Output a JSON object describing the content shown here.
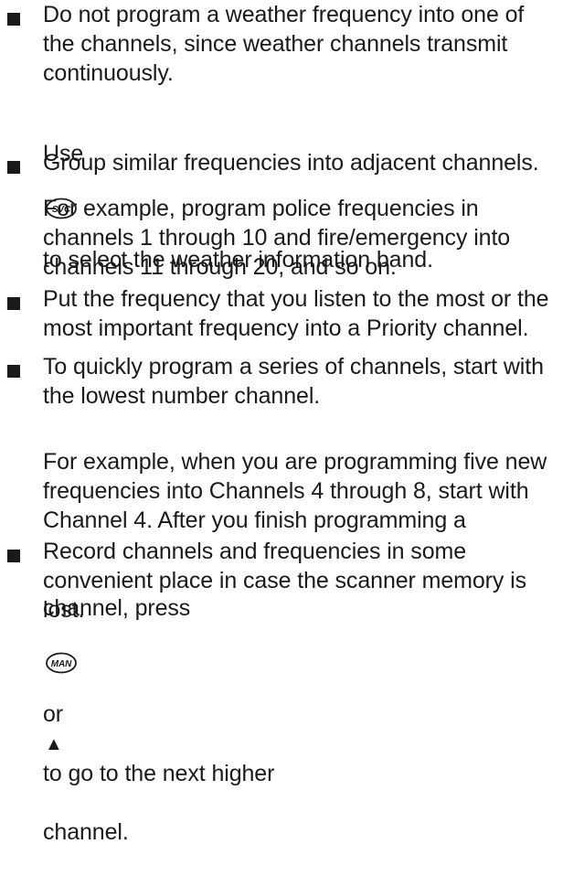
{
  "items": [
    {
      "bullet": true,
      "text": "Do not program a weather frequency into one of\nthe channels, since weather channels transmit\ncontinuously."
    },
    {
      "bullet": false,
      "text_before": "Use",
      "key": "SVC",
      "text_after": "to select the weather information band."
    },
    {
      "bullet": true,
      "text": "Group similar frequencies into adjacent channels."
    },
    {
      "bullet": false,
      "text": "For example, program police frequencies in\nchannels 1 through 10 and fire/emergency into\nchannels 11 through 20, and so on."
    },
    {
      "bullet": true,
      "text": "Put the frequency that you listen to the most or the\nmost important frequency into a Priority channel."
    },
    {
      "bullet": true,
      "text": "To quickly program a series of channels, start with\nthe lowest number channel."
    },
    {
      "bullet": false,
      "text": "For example, when you are programming five new\nfrequencies into Channels 4 through 8, start with\nChannel 4. After you finish programming a",
      "last_line_before": "channel, press",
      "key": "MAN",
      "last_line_mid": "or",
      "arrow": "▲",
      "last_line_after": "to go to the next higher",
      "final_line": "channel."
    },
    {
      "bullet": true,
      "text": "Record channels and frequencies in some\nconvenient place in case the scanner memory is\nlost."
    }
  ]
}
